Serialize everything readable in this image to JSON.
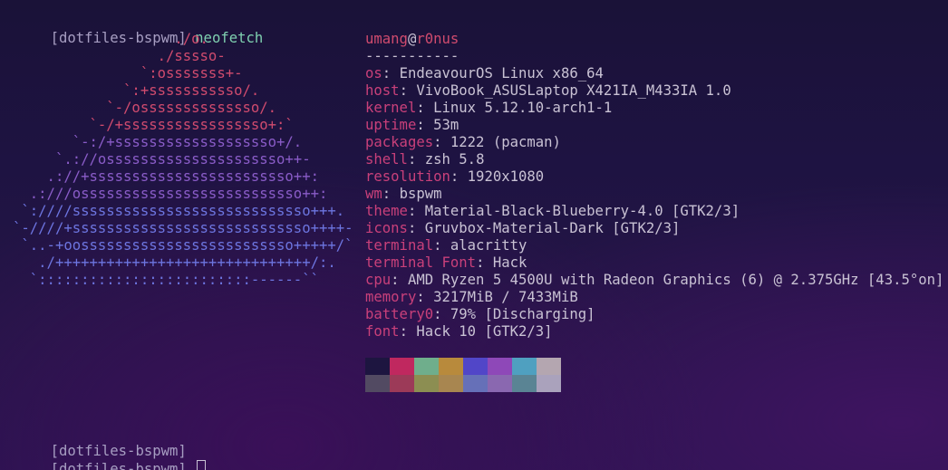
{
  "terminal": {
    "prompt_label": "[dotfiles-bspwm]",
    "command": "neofetch",
    "end_prompts": [
      "[dotfiles-bspwm]",
      "[dotfiles-bspwm]"
    ]
  },
  "ascii_logo": [
    "                   ./o.",
    "                 ./sssso-",
    "               `:osssssss+-",
    "             `:+sssssssssso/.",
    "           `-/ossssssssssssso/.",
    "         `-/+sssssssssssssssso+:`",
    "       `-:/+sssssssssssssssssso+/.",
    "     `.://osssssssssssssssssssso++-",
    "    .://+ssssssssssssssssssssssso++:",
    "  .:///ossssssssssssssssssssssssso++:",
    " `:////ssssssssssssssssssssssssssso+++.",
    "`-////+ssssssssssssssssssssssssssso++++-",
    " `..-+oosssssssssssssssssssssssso+++++/`",
    "   ./++++++++++++++++++++++++++++++/:.",
    "  `:::::::::::::::::::::::::------``"
  ],
  "info": {
    "user": "umang",
    "at": "@",
    "host": "r0nus",
    "separator": "-----------",
    "fields": [
      {
        "key": "os",
        "value": "EndeavourOS Linux x86_64"
      },
      {
        "key": "host",
        "value": "VivoBook_ASUSLaptop X421IA_M433IA 1.0"
      },
      {
        "key": "kernel",
        "value": "Linux 5.12.10-arch1-1"
      },
      {
        "key": "uptime",
        "value": "53m"
      },
      {
        "key": "packages",
        "value": "1222 (pacman)"
      },
      {
        "key": "shell",
        "value": "zsh 5.8"
      },
      {
        "key": "resolution",
        "value": "1920x1080"
      },
      {
        "key": "wm",
        "value": "bspwm"
      },
      {
        "key": "theme",
        "value": "Material-Black-Blueberry-4.0 [GTK2/3]"
      },
      {
        "key": "icons",
        "value": "Gruvbox-Material-Dark [GTK2/3]"
      },
      {
        "key": "terminal",
        "value": "alacritty"
      },
      {
        "key": "terminal Font",
        "value": "Hack"
      },
      {
        "key": "cpu",
        "value": "AMD Ryzen 5 4500U with Radeon Graphics (6) @ 2.375GHz [43.5°on]"
      },
      {
        "key": "memory",
        "value": "3217MiB / 7433MiB"
      },
      {
        "key": "battery0",
        "value": "79% [Discharging]"
      },
      {
        "key": "font",
        "value": "Hack 10 [GTK2/3]"
      }
    ]
  },
  "palette": {
    "top": [
      "#1d1540",
      "#c0285f",
      "#6fae8c",
      "#b88a3c",
      "#5146c8",
      "#8e48b8",
      "#4fa0c0",
      "#b4a6b0"
    ],
    "bottom": [
      "#524a62",
      "#9c3a58",
      "#8c8e52",
      "#a88650",
      "#6670b8",
      "#8a68b0",
      "#5a8494",
      "#aaa2bc"
    ]
  }
}
